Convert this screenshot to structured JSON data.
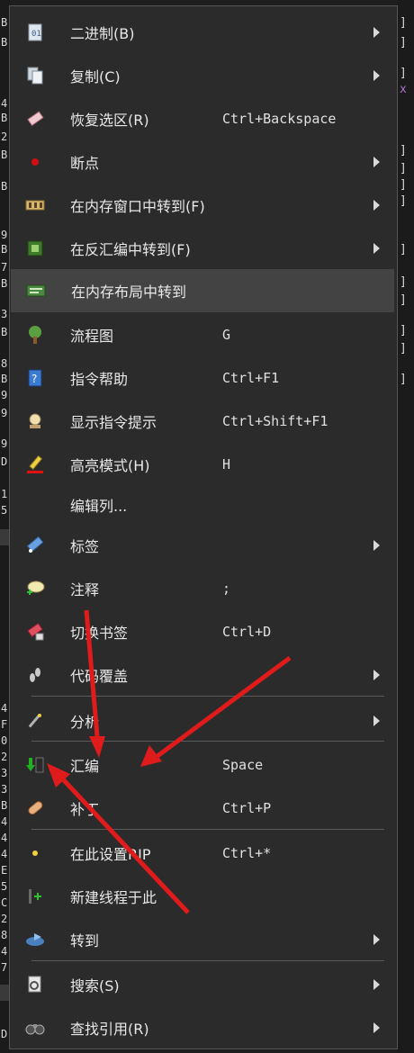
{
  "background": {
    "left_glyphs": [
      "B",
      "B",
      "4",
      "B",
      "2",
      "B",
      "B",
      "9",
      "B",
      "7",
      "B",
      "3",
      "B",
      "8",
      "B",
      "9",
      "9",
      "9",
      "D",
      "1",
      "5",
      "4",
      "F",
      "0",
      "2",
      "3",
      "3",
      "B",
      "4",
      "4",
      "4",
      "E",
      "5",
      "C",
      "2",
      "8",
      "4",
      "7",
      "D"
    ],
    "right_glyphs": [
      "]",
      "]",
      "]",
      "x",
      "]",
      "]",
      "]",
      "]",
      "]",
      "]",
      "]",
      "]",
      "]",
      "]"
    ]
  },
  "menu": {
    "items": [
      {
        "label": "二进制(B)",
        "shortcut": "",
        "submenu": true,
        "icon": "binary-doc-icon"
      },
      {
        "label": "复制(C)",
        "shortcut": "",
        "submenu": true,
        "icon": "copy-icon"
      },
      {
        "label": "恢复选区(R)",
        "shortcut": "Ctrl+Backspace",
        "submenu": false,
        "icon": "eraser-icon"
      },
      {
        "label": "断点",
        "shortcut": "",
        "submenu": true,
        "icon": "breakpoint-icon"
      },
      {
        "label": "在内存窗口中转到(F)",
        "shortcut": "",
        "submenu": true,
        "icon": "memory-window-icon"
      },
      {
        "label": "在反汇编中转到(F)",
        "shortcut": "",
        "submenu": true,
        "icon": "cpu-icon"
      },
      {
        "label": "在内存布局中转到",
        "shortcut": "",
        "submenu": false,
        "icon": "memory-map-icon"
      },
      {
        "label": "流程图",
        "shortcut": "G",
        "submenu": false,
        "icon": "graph-tree-icon"
      },
      {
        "label": "指令帮助",
        "shortcut": "Ctrl+F1",
        "submenu": false,
        "icon": "help-book-icon"
      },
      {
        "label": "显示指令提示",
        "shortcut": "Ctrl+Shift+F1",
        "submenu": false,
        "icon": "hint-icon"
      },
      {
        "label": "高亮模式(H)",
        "shortcut": "H",
        "submenu": false,
        "icon": "highlighter-icon"
      },
      {
        "label": "编辑列...",
        "shortcut": "",
        "submenu": false,
        "icon": ""
      },
      {
        "label": "标签",
        "shortcut": "",
        "submenu": true,
        "icon": "label-tag-icon"
      },
      {
        "label": "注释",
        "shortcut": ";",
        "submenu": false,
        "icon": "comment-icon"
      },
      {
        "label": "切换书签",
        "shortcut": "Ctrl+D",
        "submenu": false,
        "icon": "bookmark-icon"
      },
      {
        "label": "代码覆盖",
        "shortcut": "",
        "submenu": true,
        "icon": "footprints-icon"
      },
      {
        "label": "分析",
        "shortcut": "",
        "submenu": true,
        "icon": "magic-wand-icon"
      },
      {
        "label": "汇编",
        "shortcut": "Space",
        "submenu": false,
        "icon": "assemble-icon"
      },
      {
        "label": "补丁",
        "shortcut": "Ctrl+P",
        "submenu": false,
        "icon": "patch-icon"
      },
      {
        "label": "在此设置RIP",
        "shortcut": "Ctrl+*",
        "submenu": false,
        "icon": "set-rip-icon"
      },
      {
        "label": "新建线程于此",
        "shortcut": "",
        "submenu": false,
        "icon": "new-thread-icon"
      },
      {
        "label": "转到",
        "shortcut": "",
        "submenu": true,
        "icon": "goto-icon"
      },
      {
        "label": "搜索(S)",
        "shortcut": "",
        "submenu": true,
        "icon": "search-icon"
      },
      {
        "label": "查找引用(R)",
        "shortcut": "",
        "submenu": true,
        "icon": "binoculars-icon"
      }
    ]
  },
  "colors": {
    "menu_bg": "#2b2b2b",
    "highlight": "#434343",
    "annotation_arrow": "#e01b1b"
  }
}
